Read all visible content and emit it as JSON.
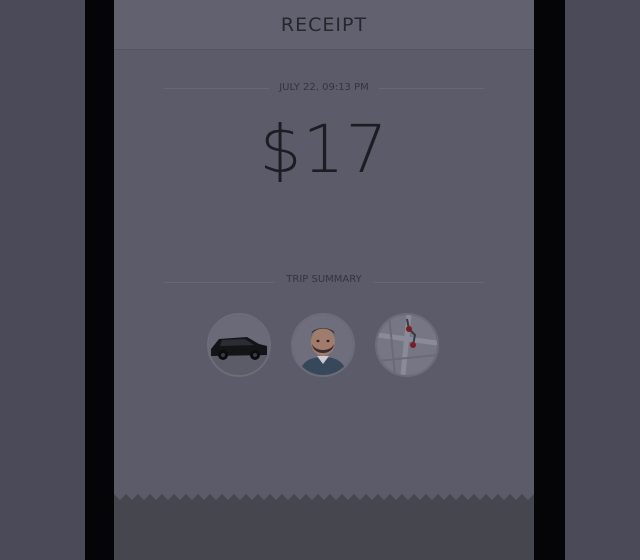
{
  "header": {
    "title": "RECEIPT"
  },
  "receipt": {
    "datetime": "JULY 22, 09:13 PM",
    "amount": "$17",
    "summary_label": "TRIP SUMMARY"
  },
  "trip_summary_items": [
    {
      "name": "vehicle",
      "icon": "car-icon"
    },
    {
      "name": "driver",
      "icon": "driver-photo"
    },
    {
      "name": "route",
      "icon": "map-icon"
    }
  ],
  "colors": {
    "page_background": "#4a4a58",
    "screen_background": "#5b5b69",
    "header_background": "#616170",
    "bezel": "#050507",
    "text_dark": "#1c1c22"
  }
}
